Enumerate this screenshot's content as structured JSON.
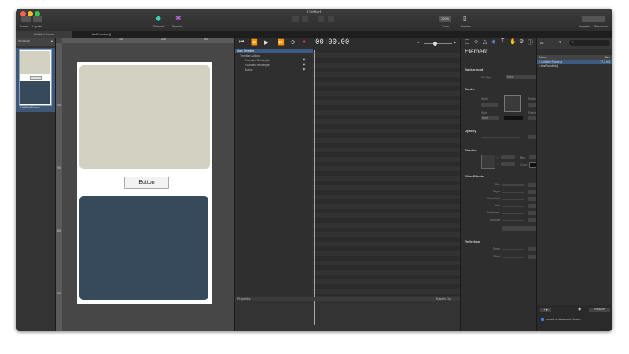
{
  "window": {
    "title": "Untitled"
  },
  "toolbar": {
    "scenes_label": "Scenes",
    "layouts_label": "Layouts",
    "elements_label": "Elements",
    "symbols_label": "Symbols",
    "zoom_value": "100%",
    "zoom_label": "Zoom",
    "preview_label": "Preview",
    "inspector_label": "Inspector",
    "resources_label": "Resources"
  },
  "tabs": {
    "scene": "Untitled Scene",
    "function": "testFunction()"
  },
  "scenes": {
    "header": "Scenes",
    "item": "Untitled Scene"
  },
  "rulers": {
    "h1": "100",
    "h2": "200",
    "h3": "300",
    "v1": "100",
    "v2": "200",
    "v3": "300",
    "v4": "400"
  },
  "stage": {
    "button_label": "Button"
  },
  "timeline": {
    "timecode": "00:00.00",
    "main_label": "Main Timeline",
    "rows": [
      "Timeline Actions",
      "Rounded Rectangle",
      "Rounded Rectangle",
      "Button"
    ],
    "properties_label": "Properties",
    "ease_label": "Ease In Out"
  },
  "inspector": {
    "title": "Element",
    "background": "Background",
    "fill_style": "Fill Style",
    "fill_value": "None",
    "border": "Border",
    "width": "Width",
    "radius": "Radius",
    "style": "Style",
    "padding": "Padding",
    "style_value": "None",
    "opacity": "Opacity",
    "shadow": "Shadow",
    "x": "X",
    "y": "Y",
    "blur": "Blur",
    "color": "Color",
    "filter_effects": "Filter Effects",
    "filters": [
      "Blur",
      "Sepia",
      "Saturation",
      "Hue",
      "Brightness",
      "Contrast"
    ],
    "reflection": "Reflection",
    "depth": "Depth",
    "offset": "Offset"
  },
  "library": {
    "filter": "All",
    "col_name": "Name",
    "col_size": "Size",
    "items": [
      {
        "name": "Untitled Scene.js",
        "size": "17.2 KB"
      },
      {
        "name": "testFunction()",
        "size": ""
      }
    ],
    "replace": "Replace",
    "include": "Include in document <head>"
  },
  "colors": {
    "accent": "#3d5a80",
    "red_light": "#fc5f57",
    "yellow_light": "#fdbc2e",
    "green_light": "#33c748"
  }
}
